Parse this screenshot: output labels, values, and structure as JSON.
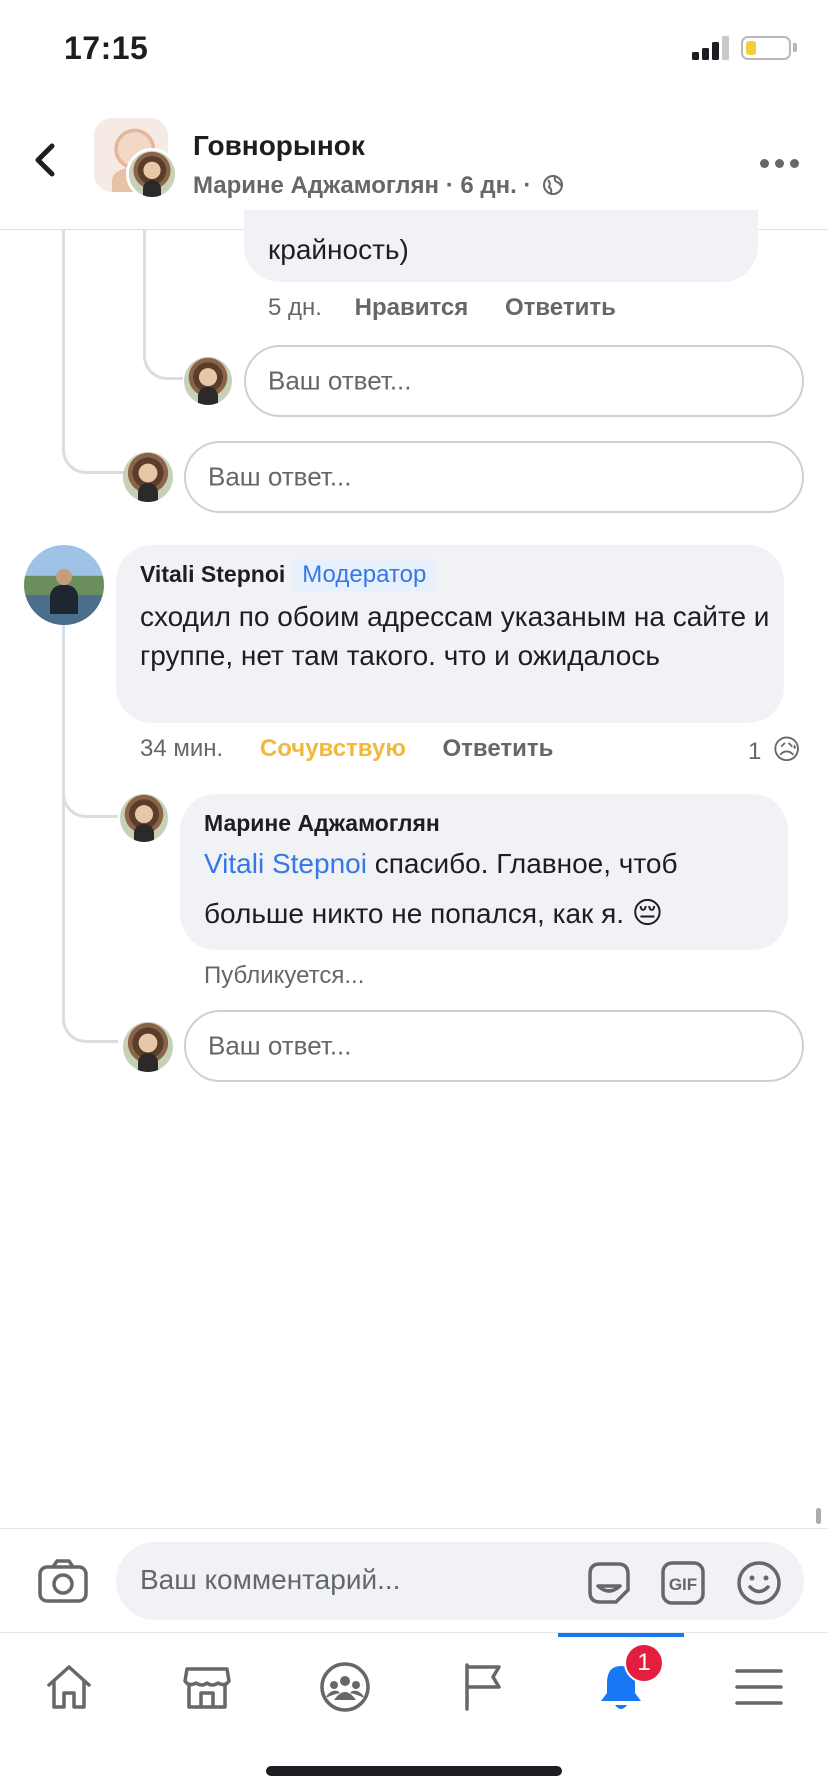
{
  "status_bar": {
    "time": "17:15",
    "battery_level": 0.25
  },
  "header": {
    "title": "Говнорынок",
    "subtitle": "Марине Аджамоглян · 6 дн. ·"
  },
  "thread": {
    "prev_comment_tail": "крайность)",
    "prev_meta": {
      "time": "5 дн.",
      "like": "Нравится",
      "reply": "Ответить"
    },
    "reply_placeholder": "Ваш ответ...",
    "comment": {
      "author": "Vitali Stepnoi",
      "badge": "Модератор",
      "text": "сходил по обоим адрессам указаным на сайте и группе, нет там такого. что и ожидалось",
      "time": "34 мин.",
      "reaction_label": "Сочувствую",
      "reply": "Ответить",
      "reaction_count": "1",
      "reaction_emoji": "😥"
    },
    "reply": {
      "author": "Марине Аджамоглян",
      "mention": "Vitali Stepnoi",
      "text_1": " спасибо. Главное, чтоб",
      "text_2": "больше никто не попался, как я.",
      "emoji": "😔",
      "status": "Публикуется..."
    }
  },
  "composer": {
    "placeholder": "Ваш комментарий..."
  },
  "tabbar": {
    "tabs": [
      "home",
      "marketplace",
      "groups",
      "pages",
      "notifications",
      "menu"
    ],
    "active_tab": "notifications",
    "notifications_badge": "1"
  },
  "colors": {
    "accent": "#1877f2",
    "reaction": "#f0b93b",
    "bubble": "#f0f2f5",
    "badge": "#e41e3f"
  }
}
